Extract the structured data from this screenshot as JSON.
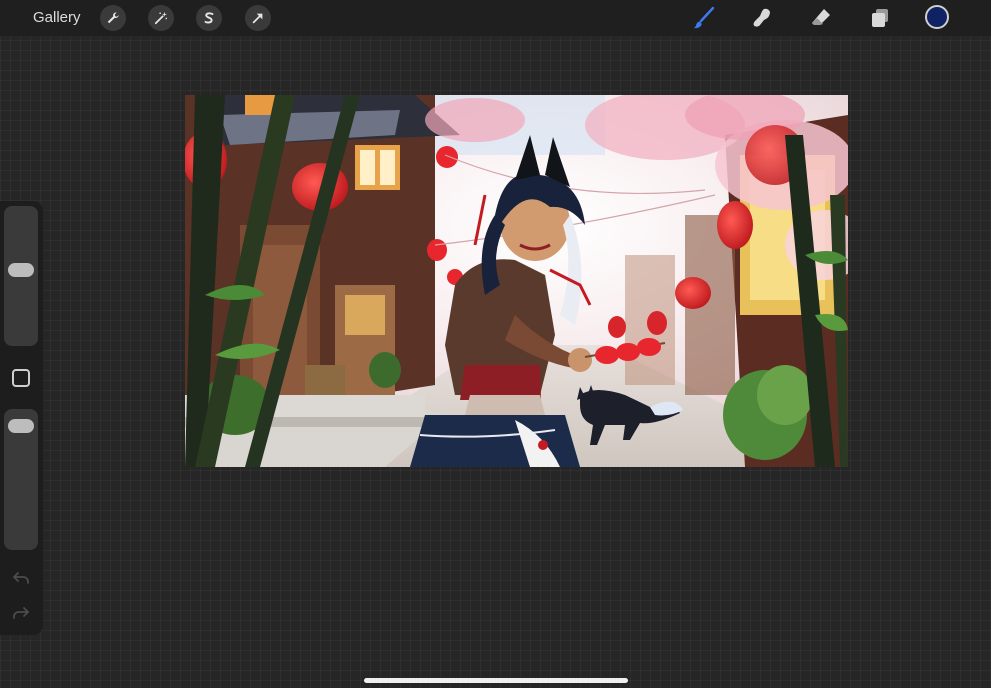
{
  "toolbar": {
    "gallery_label": "Gallery",
    "left_tools": [
      {
        "name": "actions",
        "icon": "wrench-icon"
      },
      {
        "name": "adjustments",
        "icon": "magic-wand-icon"
      },
      {
        "name": "selection",
        "icon": "selection-s-icon"
      },
      {
        "name": "transform",
        "icon": "arrow-cursor-icon"
      }
    ],
    "right_tools": [
      {
        "name": "brush",
        "icon": "brush-icon",
        "active": true
      },
      {
        "name": "smudge",
        "icon": "smudge-icon",
        "active": false
      },
      {
        "name": "eraser",
        "icon": "eraser-icon",
        "active": false
      },
      {
        "name": "layers",
        "icon": "layers-icon",
        "active": false
      }
    ],
    "current_color": "#0f2263",
    "active_tool_color": "#3a7bf0"
  },
  "sidebar": {
    "brush_size_level": 0.55,
    "opacity_level": 0.95
  },
  "colors": {
    "background": "#262626",
    "toolbar": "#1f1f1f"
  }
}
